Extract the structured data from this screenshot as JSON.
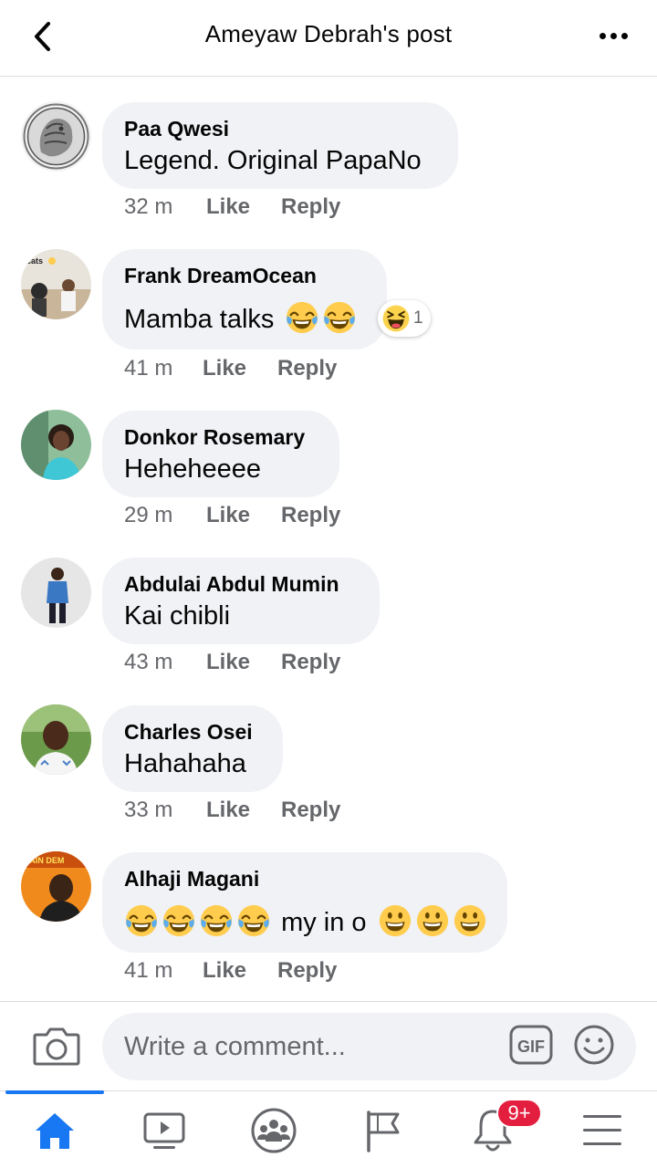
{
  "header": {
    "title": "Ameyaw Debrah's post"
  },
  "comments": [
    {
      "author": "Paa Qwesi",
      "text": "Legend. Original PapaNo",
      "time": "32 m",
      "like": "Like",
      "reply": "Reply"
    },
    {
      "author": "Frank DreamOcean",
      "text": "Mamba talks",
      "time": "41 m",
      "like": "Like",
      "reply": "Reply",
      "reaction_count": "1",
      "avatar_caption": "cats"
    },
    {
      "author": "Donkor Rosemary",
      "text": "Heheheeee",
      "time": "29 m",
      "like": "Like",
      "reply": "Reply"
    },
    {
      "author": "Abdulai Abdul Mumin",
      "text": "Kai chibli",
      "time": "43 m",
      "like": "Like",
      "reply": "Reply"
    },
    {
      "author": "Charles Osei",
      "text": "Hahahaha",
      "time": "33 m",
      "like": "Like",
      "reply": "Reply"
    },
    {
      "author": "Alhaji Magani",
      "text": "my in o",
      "time": "41 m",
      "like": "Like",
      "reply": "Reply",
      "avatar_caption": "PAIN DEM"
    }
  ],
  "composer": {
    "placeholder": "Write a comment...",
    "gif_label": "GIF"
  },
  "tabs": [
    {
      "name": "home-icon",
      "active": true
    },
    {
      "name": "watch-icon"
    },
    {
      "name": "groups-icon"
    },
    {
      "name": "pages-flag-icon"
    },
    {
      "name": "notifications-bell-icon",
      "badge": "9+"
    },
    {
      "name": "menu-icon"
    }
  ],
  "colors": {
    "accent": "#1877f2",
    "bubble": "#f0f2f5",
    "meta": "#65676b",
    "badge": "#e41e3f"
  }
}
